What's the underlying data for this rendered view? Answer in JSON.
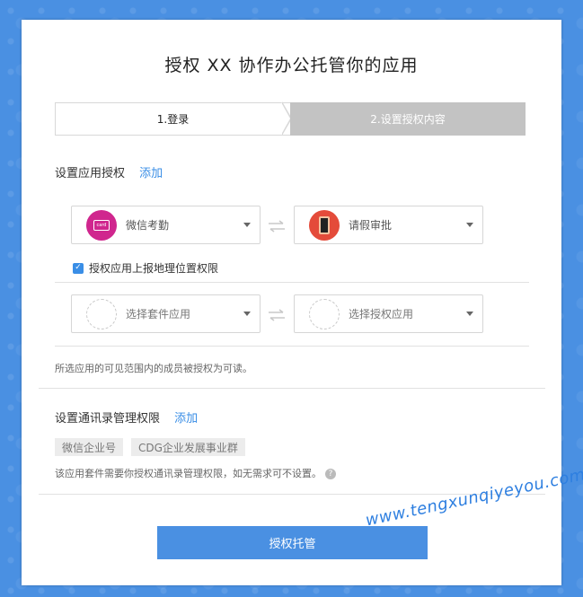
{
  "page": {
    "title": "授权 XX 协作办公托管你的应用"
  },
  "steps": [
    {
      "label": "1.登录",
      "active": true
    },
    {
      "label": "2.设置授权内容",
      "active": false
    }
  ],
  "app_auth": {
    "heading": "设置应用授权",
    "add_label": "添加",
    "pairs": [
      {
        "left": {
          "label": "微信考勤",
          "icon": "attendance-card-icon",
          "icon_color": "#d0268e"
        },
        "right": {
          "label": "请假审批",
          "icon": "leave-approval-icon",
          "icon_color": "#e44b3a"
        }
      },
      {
        "left": {
          "placeholder": "选择套件应用"
        },
        "right": {
          "placeholder": "选择授权应用"
        }
      }
    ],
    "checkbox": {
      "label": "授权应用上报地理位置权限",
      "checked": true
    },
    "note": "所选应用的可见范围内的成员被授权为可读。"
  },
  "contacts_auth": {
    "heading": "设置通讯录管理权限",
    "add_label": "添加",
    "tags": [
      "微信企业号",
      "CDG企业发展事业群"
    ],
    "note": "该应用套件需要你授权通讯录管理权限，如无需求可不设置。"
  },
  "submit_label": "授权托管",
  "watermark": "www.tengxunqiyeyou.com",
  "colors": {
    "accent": "#4a90e2",
    "link": "#3a8ee6",
    "step_inactive": "#c3c3c3"
  }
}
